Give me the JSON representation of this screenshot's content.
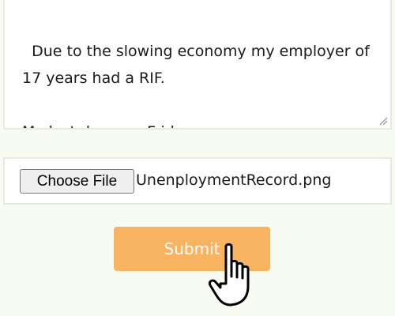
{
  "message": {
    "text": "Due to the slowing economy my employer of\n17 years had a RIF.\n\nMy last day was Friday."
  },
  "file_upload": {
    "button_label": "Choose File",
    "file_name": "UnenploymentRecord.png"
  },
  "submit": {
    "label": "Submit"
  },
  "cursor": {
    "icon": "hand-pointer-icon"
  },
  "colors": {
    "page_background": "#f7fbf1",
    "submit_background": "#f8b460",
    "submit_text": "#ffffff"
  }
}
